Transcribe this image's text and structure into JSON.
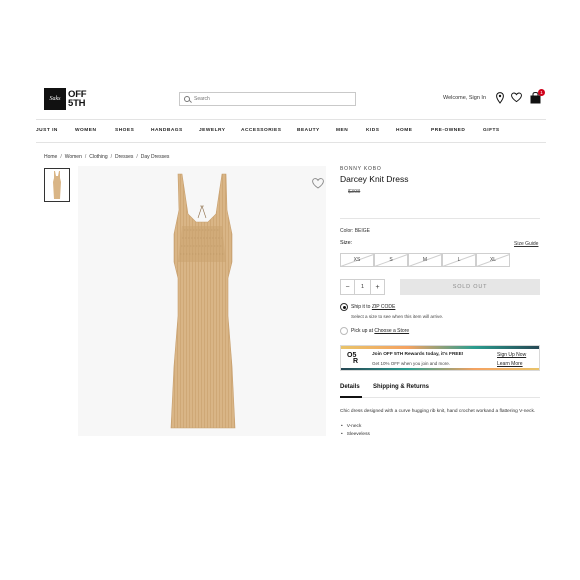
{
  "header": {
    "logo_mark": "Saks",
    "logo_line1": "OFF",
    "logo_line2": "5TH",
    "search_placeholder": "Search",
    "welcome": "Welcome, Sign In",
    "cart_count": "1"
  },
  "nav": [
    "JUST IN",
    "WOMEN",
    "SHOES",
    "HANDBAGS",
    "JEWELRY",
    "ACCESSORIES",
    "BEAUTY",
    "MEN",
    "KIDS",
    "HOME",
    "PRE-OWNED",
    "GIFTS"
  ],
  "breadcrumb": [
    "Home",
    "Women",
    "Clothing",
    "Dresses",
    "Day Dresses"
  ],
  "product": {
    "brand": "BONNY KOBO",
    "title": "Darcey Knit Dress",
    "price": "$398",
    "color_label": "Color: BEIGE",
    "size_label": "Size:",
    "size_guide": "Size Guide",
    "sizes": [
      "XS",
      "S",
      "M",
      "L",
      "XL"
    ],
    "quantity": "1",
    "qty_minus": "−",
    "qty_plus": "+",
    "sold_out": "SOLD OUT"
  },
  "fulfillment": {
    "ship_prefix": "Ship it to ",
    "ship_link": "ZIP CODE",
    "ship_sub": "Select a size to see when this item will arrive.",
    "pickup_prefix": "Pick up at ",
    "pickup_link": "Choose a Store"
  },
  "rewards": {
    "logo_top": "O5",
    "logo_bottom": "R",
    "title": "Join OFF 5TH Rewards today, it's FREE!",
    "subtitle": "Get 10% OFF when you join and more.",
    "signup": "Sign Up Now",
    "learn": "Learn More"
  },
  "tabs": {
    "details": "Details",
    "shipping": "Shipping & Returns"
  },
  "details": {
    "description": "Chic dress designed with a curve hugging rib knit, hand crochet workand a flattering V-neck.",
    "bullets": [
      "V-neck",
      "Sleeveless"
    ]
  },
  "colors": {
    "dress": "#d9b586",
    "sold_out_bg": "#e6e6e6",
    "badge": "#d0021b"
  }
}
